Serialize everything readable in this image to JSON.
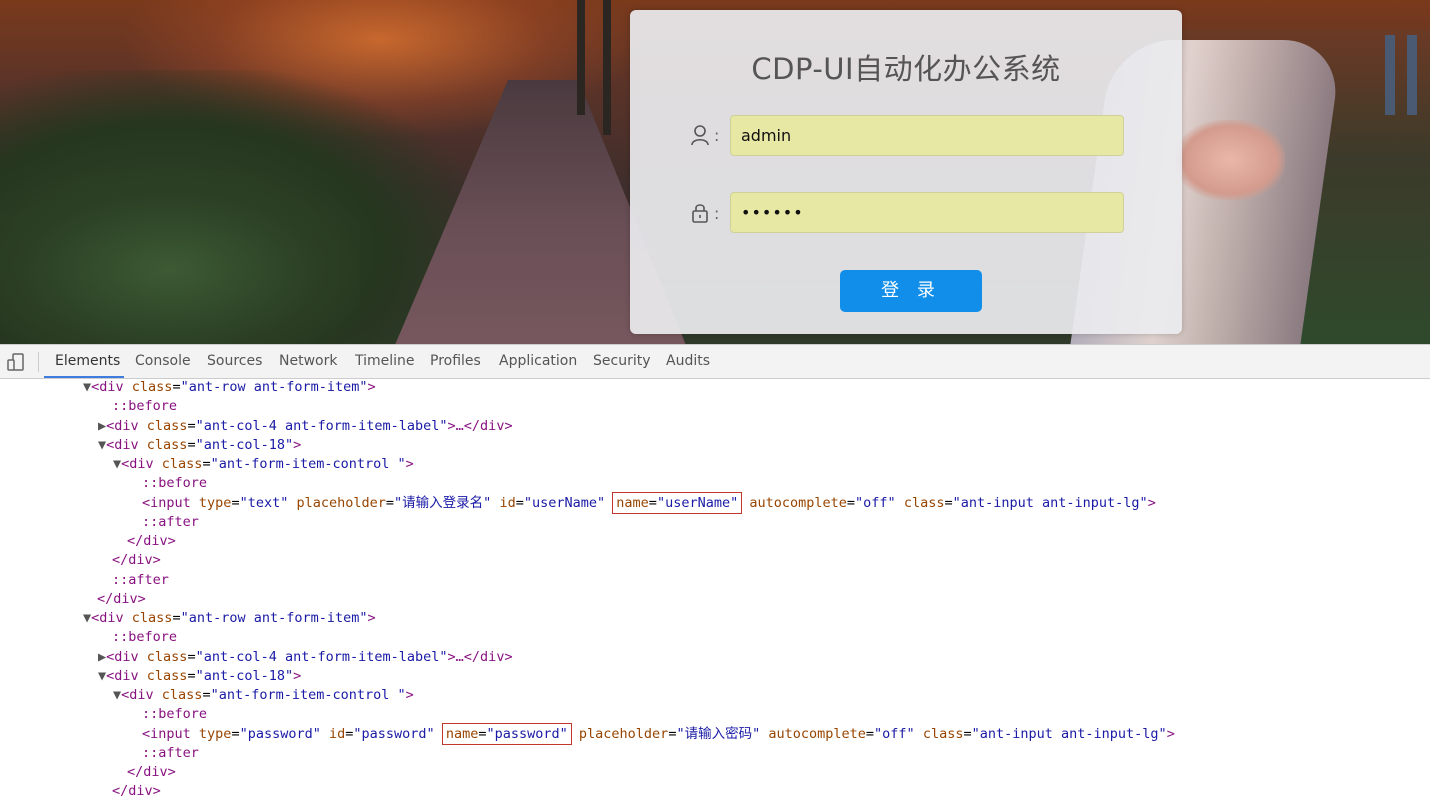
{
  "login": {
    "title": "CDP-UI自动化办公系统",
    "username_value": "admin",
    "password_value": "••••••",
    "colon": ":",
    "submit_label": "登 录"
  },
  "devtools": {
    "tabs": [
      "Elements",
      "Console",
      "Sources",
      "Network",
      "Timeline",
      "Profiles",
      "Application",
      "Security",
      "Audits"
    ],
    "active_tab": "Elements",
    "accent_color": "#3e7cde"
  },
  "code": {
    "l1_tri": "▼",
    "l1_open": "<div",
    "l1_attr": "class",
    "l1_val": "\"ant-row ant-form-item\"",
    "l1_close": ">",
    "before": "::before",
    "after": "::after",
    "l3_tri": "▶",
    "l3_open": "<div",
    "l3_attr": "class",
    "l3_val": "\"ant-col-4 ant-form-item-label\"",
    "l3_tail": ">…</div>",
    "l4_tri": "▼",
    "l4_open": "<div",
    "l4_attr": "class",
    "l4_val": "\"ant-col-18\"",
    "l4_close": ">",
    "l5_tri": "▼",
    "l5_open": "<div",
    "l5_attr": "class",
    "l5_val": "\"ant-form-item-control \"",
    "l5_close": ">",
    "input1": {
      "open": "<input",
      "type_attr": "type",
      "type_val": "\"text\"",
      "ph_attr": "placeholder",
      "ph_val": "\"请输入登录名\"",
      "id_attr": "id",
      "id_val": "\"userName\"",
      "name_attr": "name",
      "name_val": "\"userName\"",
      "ac_attr": "autocomplete",
      "ac_val": "\"off\"",
      "class_attr": "class",
      "class_val": "\"ant-input ant-input-lg\"",
      "close": ">"
    },
    "input2": {
      "open": "<input",
      "type_attr": "type",
      "type_val": "\"password\"",
      "id_attr": "id",
      "id_val": "\"password\"",
      "name_attr": "name",
      "name_val": "\"password\"",
      "ph_attr": "placeholder",
      "ph_val": "\"请输入密码\"",
      "ac_attr": "autocomplete",
      "ac_val": "\"off\"",
      "class_attr": "class",
      "class_val": "\"ant-input ant-input-lg\"",
      "close": ">"
    },
    "close_div": "</div>"
  }
}
